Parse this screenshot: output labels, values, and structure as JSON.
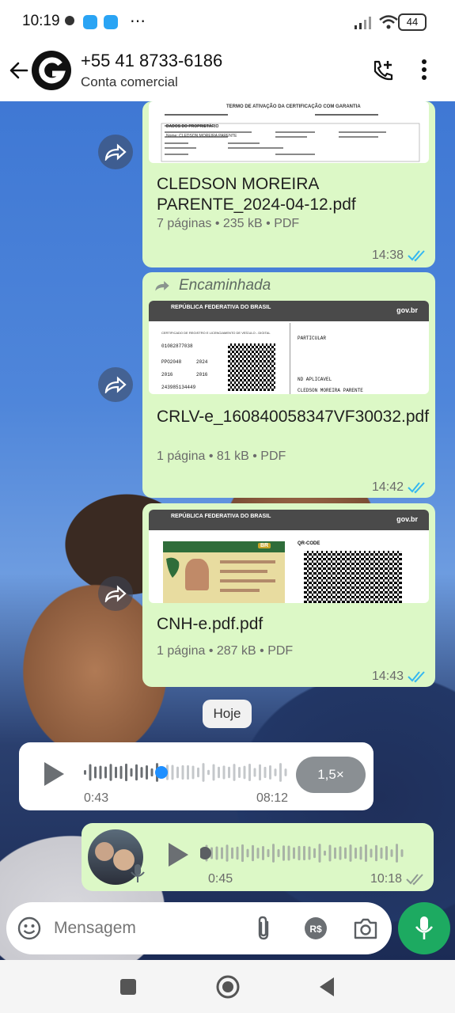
{
  "status_bar": {
    "time": "10:19",
    "battery": "44"
  },
  "header": {
    "title": "+55 41 8733-6186",
    "subtitle": "Conta comercial"
  },
  "messages": [
    {
      "file_name": "CLEDSON MOREIRA PARENTE_2024-04-12.pdf",
      "meta": "7 páginas • 235 kB • PDF",
      "time": "14:38",
      "preview": {
        "heading": "TERMO DE ATIVAÇÃO DA CERTIFICAÇÃO COM GARANTIA",
        "owner_label": "DADOS DO PROPRIETÁRIO",
        "name": "Nome: CLEDSON MOREIRA PARENTE"
      }
    },
    {
      "forwarded_label": "Encaminhada",
      "file_name": "CRLV-e_160840058347VF30032.pdf",
      "meta": "1 página • 81 kB • PDF",
      "time": "14:42",
      "preview": {
        "republic": "REPÚBLICA FEDERATIVA DO BRASIL",
        "govbr": "gov.br",
        "doc": "CERTIFICADO DE REGISTRO E LICENCIAMENTO DE VEÍCULO - DIGITAL",
        "renavam": "01082877038",
        "plate": "PPO2048",
        "year": "2024",
        "fabric": "2016",
        "model": "2016",
        "owner": "CLEDSON MOREIRA PARENTE",
        "category": "PARTICULAR",
        "chassis": "ND APLICAVEL",
        "code": "243985134449"
      }
    },
    {
      "file_name": "CNH-e.pdf.pdf",
      "meta": "1 página • 287 kB • PDF",
      "time": "14:43",
      "preview": {
        "republic": "REPÚBLICA FEDERATIVA DO BRASIL",
        "govbr": "gov.br",
        "qr": "QR-CODE",
        "br": "BR"
      }
    }
  ],
  "date_chip": "Hoje",
  "audio_in": {
    "elapsed": "0:43",
    "duration": "08:12",
    "speed": "1,5×"
  },
  "audio_out": {
    "elapsed": "0:45",
    "time": "10:18"
  },
  "input": {
    "placeholder": "Mensagem"
  },
  "colors": {
    "outgoing_bubble": "#dcf8c6",
    "accent_green": "#1daa61",
    "tick_blue": "#34b7f1"
  },
  "icons": [
    "back-arrow-icon",
    "call-add-icon",
    "more-vert-icon",
    "forward-icon",
    "play-icon",
    "mic-icon",
    "emoji-icon",
    "attach-icon",
    "payment-icon",
    "camera-icon",
    "nav-square-icon",
    "nav-circle-icon",
    "nav-back-icon"
  ]
}
